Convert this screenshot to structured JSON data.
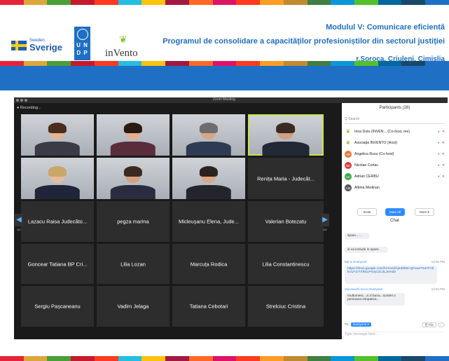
{
  "colors": {
    "brand_blue": "#1f6fc4",
    "stripe": [
      "#e5243b",
      "#dda63a",
      "#4c9f38",
      "#c5192d",
      "#ff3a21",
      "#26bde2",
      "#fcc30b",
      "#a21942",
      "#fd6925",
      "#dd1367",
      "#ff3a21",
      "#fd9d24",
      "#bf8b2e",
      "#3f7e44",
      "#0a97d9",
      "#56c02b",
      "#00689d",
      "#19486a",
      "#1f6fc4"
    ]
  },
  "header": {
    "sweden_small": "Sweden",
    "sweden_big": "Sverige",
    "undp_row1": "U N",
    "undp_row2": "D P",
    "invento": "inVento",
    "title_line1": "Modulul V: Comunicare eficientă",
    "title_line2": "Programul de consolidare a capacităților profesioniștilor din sectorul justiției",
    "title_line3": "r.Soroca, Criuleni, Cimișlia"
  },
  "zoom": {
    "window_title": "Zoom Meeting",
    "recording": "Recording...",
    "page_left": "1/2",
    "page_right": "1/2",
    "tiles_names": [
      "Renița Maria - Judecăt...",
      "Lazacu Raisa Judecăto...",
      "pegza marina",
      "Micleușanu Elena, Jude...",
      "Valerian Botezatu",
      "Goncear Tatiana BP Cri...",
      "Lilia Lozan",
      "Marcuța Rodica",
      "Lilia Constantinescu",
      "Sergiu Pașcaneanu",
      "Vadim Jelaga",
      "Tatiana Cebotari",
      "Strelciuc Cristina"
    ]
  },
  "participants": {
    "header": "Participants (28)",
    "search_placeholder": "Q  Search",
    "rows": [
      {
        "initials": "",
        "name": "Irina Dutu (INVEN...   (Co-host, me)",
        "color": "#8bbf3a"
      },
      {
        "initials": "",
        "name": "Asociația INVENTO (Host)",
        "color": "#8bbf3a"
      },
      {
        "initials": "AR",
        "name": "Angelica Rusu (Co-host)",
        "color": "#e07b39"
      },
      {
        "initials": "NC",
        "name": "Nicolae Cortac",
        "color": "#e0383b"
      },
      {
        "initials": "AC",
        "name": "Adrian CERBU",
        "color": "#3aa845"
      },
      {
        "initials": "AM",
        "name": "Albina Medinan",
        "color": "#555"
      }
    ],
    "invite": "Invite",
    "mute_all": "Mute All",
    "more": "More ▾"
  },
  "chat": {
    "header": "Chat",
    "msg1": "spam...   ...",
    "msg2": "si va include in spam..",
    "from1": "Me to Everyone",
    "time1": "12:03 PM",
    "link1": "https://docs.google.com/forms/d/1jsd0kW-QFuueTS4rTC6kVLF1rTXfWLPKnjCZL3LJe/edit",
    "from2": "Voicovechi Ion to Everyone",
    "time2": "12:04 PM",
    "msg3": "multumesc...a zi buna...sunteti o persoana simpatica...",
    "to_label": "To:",
    "to_value": "Everyone ▾",
    "file": "File",
    "more": "···",
    "input_placeholder": "Type message here..."
  }
}
